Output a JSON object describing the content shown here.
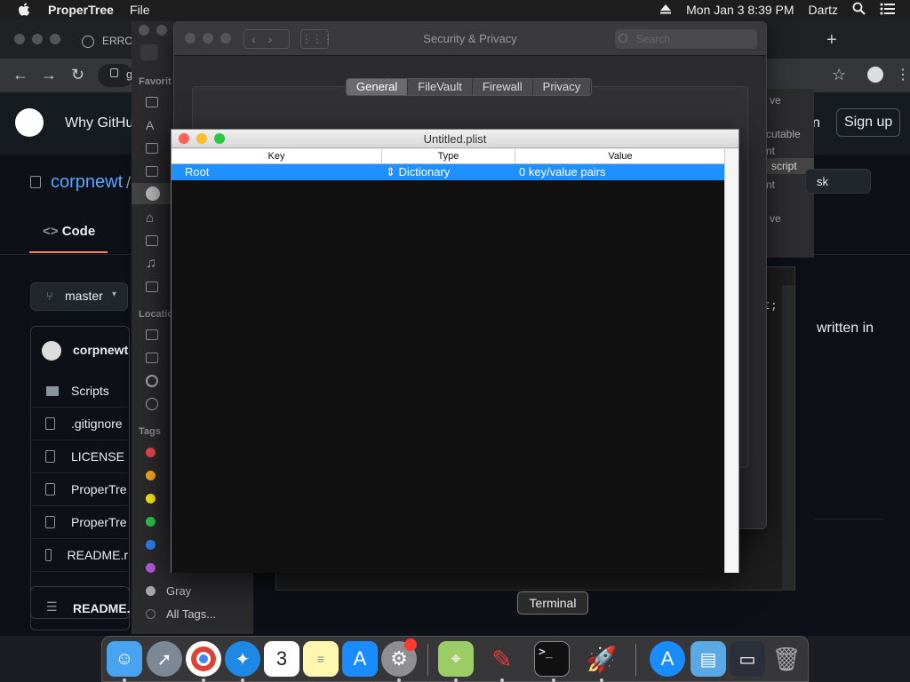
{
  "menubar": {
    "app_name": "ProperTree",
    "file_menu": "File",
    "clock": "Mon Jan 3  8:39 PM",
    "user": "Dartz"
  },
  "chrome": {
    "tab_title": "ERRO",
    "addr_partial": "g"
  },
  "github": {
    "why_github": "Why GitHu",
    "sign_in_partial": "n",
    "sign_up": "Sign up",
    "repo_owner": "corpnewt",
    "repo_sep": "/",
    "code_tab": "Code",
    "branch": "master",
    "commit_author": "corpnewt",
    "files": [
      "Scripts",
      ".gitignore",
      "LICENSE",
      "ProperTre",
      "ProperTre",
      "README.r"
    ],
    "readme_header": "README.",
    "written_in": "written in",
    "ask_partial": "sk"
  },
  "finder": {
    "favorites_header": "Favorit",
    "locations_header": "Locatio",
    "tags_header": "Tags",
    "tag_gray": "Gray",
    "all_tags": "All Tags...",
    "tag_colors": [
      "#e5484d",
      "#f5a623",
      "#f8e71c",
      "#30c04f",
      "#2f80ed",
      "#b05ad9"
    ]
  },
  "security": {
    "title": "Security & Privacy",
    "search_placeholder": "Search",
    "tabs": [
      "General",
      "FileVault",
      "Firewall",
      "Privacy"
    ],
    "active_tab": "General"
  },
  "right_panel": {
    "items": [
      "ve",
      "cutable",
      "nt",
      "script",
      "nt",
      "ve"
    ]
  },
  "editor": {
    "code_fragment": "t;"
  },
  "propertree": {
    "title": "Untitled.plist",
    "columns": [
      "Key",
      "Type",
      "Value"
    ],
    "rows": [
      {
        "key": "Root",
        "type": "Dictionary",
        "value": "0 key/value pairs"
      }
    ]
  },
  "tooltip": "Terminal",
  "colors": {
    "selection": "#1e90ff",
    "traffic_red": "#ff5f57",
    "traffic_yellow": "#febc2e",
    "traffic_green": "#28c840"
  }
}
